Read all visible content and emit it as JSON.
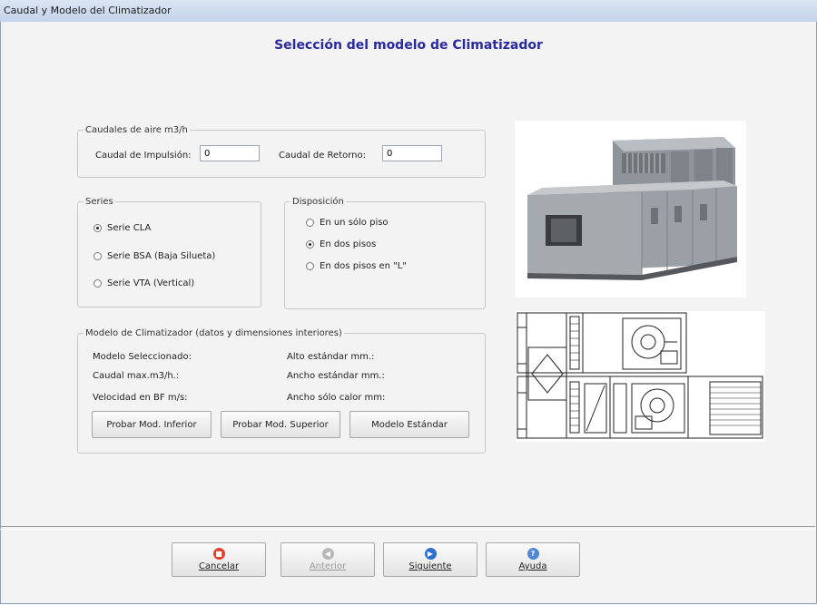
{
  "window": {
    "title": "Caudal y Modelo del Climatizador"
  },
  "heading": "Selección del modelo de Climatizador",
  "caudales": {
    "legend": "Caudales de aire m3/h",
    "impulsion_label": "Caudal de Impulsión:",
    "impulsion_value": "0",
    "retorno_label": "Caudal de Retorno:",
    "retorno_value": "0"
  },
  "series": {
    "legend": "Series",
    "options": [
      {
        "label": "Serie CLA",
        "selected": true
      },
      {
        "label": "Serie BSA (Baja Silueta)",
        "selected": false
      },
      {
        "label": "Serie VTA (Vertical)",
        "selected": false
      }
    ]
  },
  "disposicion": {
    "legend": "Disposición",
    "options": [
      {
        "label": "En un sólo piso",
        "selected": false
      },
      {
        "label": "En dos pisos",
        "selected": true
      },
      {
        "label": "En dos pisos en \"L\"",
        "selected": false
      }
    ]
  },
  "modelo": {
    "legend": "Modelo de Climatizador (datos y dimensiones interiores)",
    "left_labels": [
      "Modelo Seleccionado:",
      "Caudal max.m3/h.:",
      "Velocidad en BF m/s:"
    ],
    "right_labels": [
      "Alto estándar mm.:",
      "Ancho estándar mm.:",
      "Ancho sólo calor mm:"
    ],
    "buttons": [
      "Probar Mod. Inferior",
      "Probar Mod. Superior",
      "Modelo Estándar"
    ]
  },
  "footer": {
    "buttons": [
      {
        "label": "Cancelar",
        "icon": "stop-icon",
        "color": "#e0402a",
        "enabled": true
      },
      {
        "label": "Anterior",
        "icon": "back-arrow-icon",
        "color": "#b8b8b8",
        "enabled": false
      },
      {
        "label": "Siguiente",
        "icon": "next-arrow-icon",
        "color": "#2e6fd0",
        "enabled": true
      },
      {
        "label": "Ayuda",
        "icon": "help-icon",
        "color": "#4f86d6",
        "enabled": true
      }
    ]
  },
  "colors": {
    "heading": "#2a2aa0",
    "background": "#f3f3f3"
  }
}
